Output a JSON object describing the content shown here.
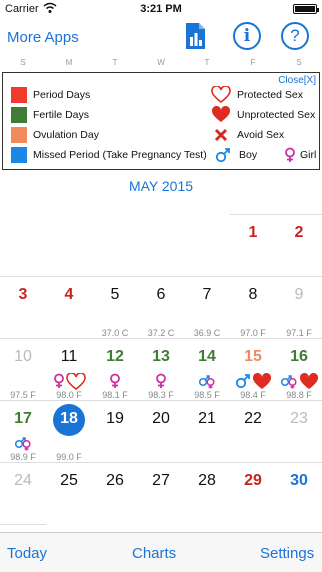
{
  "status_bar": {
    "carrier": "Carrier",
    "time": "3:21 PM"
  },
  "nav": {
    "more_apps": "More Apps"
  },
  "weekdays": [
    "S",
    "M",
    "T",
    "W",
    "T",
    "F",
    "S"
  ],
  "legend": {
    "close": "Close[X]",
    "items": [
      {
        "label": "Period Days",
        "color": "#f03a2c"
      },
      {
        "label": "Fertile Days",
        "color": "#3f7d35"
      },
      {
        "label": "Ovulation Day",
        "color": "#f08a5c"
      },
      {
        "label": "Missed Period (Take Pregnancy Test)",
        "color": "#1a88e6"
      }
    ],
    "sex_items": [
      {
        "label": "Protected Sex",
        "icon": "outline-heart-icon"
      },
      {
        "label": "Unprotected Sex",
        "icon": "filled-heart-icon"
      },
      {
        "label": "Avoid Sex",
        "icon": "x-icon"
      }
    ],
    "gender": {
      "boy": "Boy",
      "girl": "Girl"
    }
  },
  "month_title": "MAY 2015",
  "calendar": {
    "colors": {
      "period": "#c8241f",
      "fertile": "#3f7d35",
      "ovulation": "#f08a5c",
      "missed": "#1a74d6",
      "muted": "#bbb",
      "normal": "#111"
    },
    "days": [
      {
        "day": "1",
        "kind": "period"
      },
      {
        "day": "2",
        "kind": "period"
      },
      {
        "day": "3",
        "kind": "period"
      },
      {
        "day": "4",
        "kind": "period"
      },
      {
        "day": "5",
        "kind": "normal"
      },
      {
        "day": "6",
        "kind": "normal"
      },
      {
        "day": "7",
        "kind": "normal"
      },
      {
        "day": "8",
        "kind": "normal"
      },
      {
        "day": "9",
        "kind": "muted"
      },
      {
        "day": "10",
        "kind": "muted"
      },
      {
        "day": "11",
        "kind": "normal"
      },
      {
        "day": "12",
        "kind": "fertile"
      },
      {
        "day": "13",
        "kind": "fertile"
      },
      {
        "day": "14",
        "kind": "fertile"
      },
      {
        "day": "15",
        "kind": "ovulation"
      },
      {
        "day": "16",
        "kind": "fertile"
      },
      {
        "day": "17",
        "kind": "fertile"
      },
      {
        "day": "18",
        "kind": "today"
      },
      {
        "day": "19",
        "kind": "normal"
      },
      {
        "day": "20",
        "kind": "normal"
      },
      {
        "day": "21",
        "kind": "normal"
      },
      {
        "day": "22",
        "kind": "normal"
      },
      {
        "day": "23",
        "kind": "muted"
      },
      {
        "day": "24",
        "kind": "muted"
      },
      {
        "day": "25",
        "kind": "normal"
      },
      {
        "day": "26",
        "kind": "normal"
      },
      {
        "day": "27",
        "kind": "normal"
      },
      {
        "day": "28",
        "kind": "normal"
      },
      {
        "day": "29",
        "kind": "period"
      },
      {
        "day": "30",
        "kind": "missed"
      }
    ],
    "temps": {
      "5": "37.0 C",
      "6": "37.2 C",
      "7": "36.9 C",
      "8": "97.0 F",
      "9": "97.1 F",
      "10": "97.5 F",
      "11": "98.0 F",
      "12": "98.1 F",
      "13": "98.3 F",
      "14": "98.5 F",
      "15": "98.4 F",
      "16": "98.8 F",
      "17": "98.9 F",
      "18": "99.0 F"
    },
    "icons": {
      "11": [
        "girl",
        "heart-outline"
      ],
      "12": [
        "girl"
      ],
      "13": [
        "girl"
      ],
      "14": [
        "both"
      ],
      "15": [
        "boy",
        "heart"
      ],
      "16": [
        "both",
        "heart"
      ],
      "17": [
        "both"
      ]
    }
  },
  "tabbar": {
    "today": "Today",
    "charts": "Charts",
    "settings": "Settings"
  }
}
